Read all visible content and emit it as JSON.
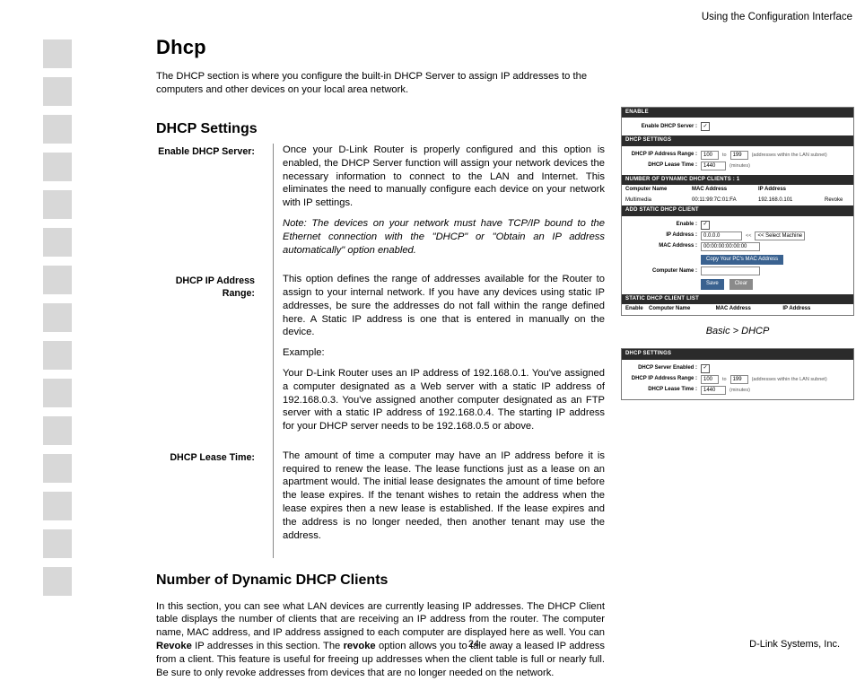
{
  "header": {
    "section": "Using the Configuration Interface"
  },
  "title": "Dhcp",
  "intro": "The DHCP section is where you configure the built-in DHCP Server to assign IP addresses to the computers and other devices on your local area network.",
  "settings": {
    "heading": "DHCP Settings",
    "items": [
      {
        "label": "Enable DHCP Server:",
        "body": "Once your D-Link Router is properly configured and this option is enabled, the DHCP Server function will assign your network devices the necessary information to connect to the LAN and Internet. This eliminates the need to manually configure each device on your network with IP settings.",
        "note": "Note: The devices on your network must have TCP/IP bound to the Ethernet connection with the \"DHCP\" or \"Obtain an IP address automatically\" option enabled."
      },
      {
        "label": "DHCP IP Address Range:",
        "body": "This option defines the range of addresses available for the Router to assign to your internal network. If you have any devices using static IP addresses, be sure the addresses do not fall within the range defined here. A Static IP address is one that is entered in manually on the device.",
        "example_label": "Example:",
        "example": "Your D-Link Router uses an IP address of 192.168.0.1. You've assigned a computer designated as a Web server with a static IP address of 192.168.0.3. You've assigned another computer designated as an FTP server with a static IP address of 192.168.0.4. The starting IP address for your DHCP server needs to be 192.168.0.5 or above."
      },
      {
        "label": "DHCP Lease Time:",
        "body": "The amount of time a computer may have an IP address before it is required to renew the lease. The lease functions just as a lease on an apartment would. The initial lease designates the amount of time before the lease expires. If the tenant wishes to retain the address when the lease expires then a new lease is established. If the lease expires and the address is no longer needed, then another tenant may use the address."
      }
    ]
  },
  "clients": {
    "heading": "Number of Dynamic DHCP Clients",
    "p1": "In this section, you can see what LAN devices are currently leasing IP addresses. The DHCP Client table displays the number of clients that are receiving an IP address from the router. The computer name, MAC address, and IP address assigned to each computer are displayed here as well. You can ",
    "revoke1": "Revoke",
    "p2": " IP addresses in this section. The ",
    "revoke2": "revoke",
    "p3": " option allows you to tale away a leased IP address from a client. This feature is useful for freeing up addresses when the client table is full or nearly full. Be sure to only revoke addresses from devices that are no longer needed on the network."
  },
  "shot1": {
    "enable_bar": "ENABLE",
    "enable_label": "Enable DHCP Server :",
    "settings_bar": "DHCP SETTINGS",
    "range_label": "DHCP IP Address Range :",
    "range_from": "100",
    "range_to": "199",
    "range_hint": "(addresses within the LAN subnet)",
    "lease_label": "DHCP Lease Time :",
    "lease_val": "1440",
    "lease_hint": "(minutes)",
    "dyn_bar": "NUMBER OF DYNAMIC DHCP CLIENTS : 1",
    "col_name": "Computer Name",
    "col_mac": "MAC Address",
    "col_ip": "IP Address",
    "row_name": "Multimedia",
    "row_mac": "00:11:99:7C:01:FA",
    "row_ip": "192.168.0.101",
    "row_act": "Revoke",
    "add_bar": "ADD STATIC DHCP CLIENT",
    "add_enable": "Enable :",
    "add_ip": "IP Address :",
    "add_ip_val": "0.0.0.0",
    "add_sel": "<< Select Machine",
    "add_mac": "MAC Address :",
    "add_mac_val": "00:00:00:00:00:00",
    "copy_btn": "Copy Your PC's MAC Address",
    "add_name": "Computer Name :",
    "save": "Save",
    "clear": "Clear",
    "list_bar": "STATIC DHCP CLIENT LIST",
    "list_en": "Enable",
    "list_name": "Computer Name",
    "list_mac": "MAC Address",
    "list_ip": "IP Address",
    "caption": "Basic > DHCP"
  },
  "shot2": {
    "bar": "DHCP SETTINGS",
    "enabled_label": "DHCP Server Enabled :",
    "range_label": "DHCP IP Address Range :",
    "range_from": "100",
    "to": "to",
    "range_to": "199",
    "range_hint": "(addresses within the LAN subnet)",
    "lease_label": "DHCP Lease Time :",
    "lease_val": "1440",
    "lease_hint": "(minutes)"
  },
  "footer": {
    "page": "24",
    "company": "D-Link Systems, Inc."
  }
}
